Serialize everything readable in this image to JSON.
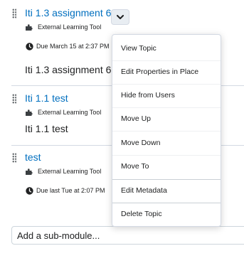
{
  "topics": [
    {
      "title": "Iti 1.3 assignment 6",
      "type": "External Learning Tool",
      "due": "Due March 15 at 2:37 PM",
      "description": "Iti 1.3 assignment 6"
    },
    {
      "title": "Iti 1.1 test",
      "type": "External Learning Tool",
      "description": "Iti 1.1 test"
    },
    {
      "title": "test",
      "type": "External Learning Tool",
      "due": "Due last Tue at 2:07 PM"
    }
  ],
  "add_sub_module": {
    "label": "Add a sub-module..."
  },
  "context_menu": {
    "items": [
      "View Topic",
      "Edit Properties in Place",
      "Hide from Users",
      "Move Up",
      "Move Down",
      "Move To",
      "Edit Metadata",
      "Delete Topic"
    ]
  },
  "icons": {
    "drag": "drag-handle-icon",
    "tool": "puzzle-piece-icon",
    "due": "clock-icon",
    "menu": "chevron-down-icon"
  },
  "colors": {
    "link": "#006fbf",
    "text": "#202122",
    "button_bg": "#e8edf2",
    "border": "#d3d9e3"
  }
}
